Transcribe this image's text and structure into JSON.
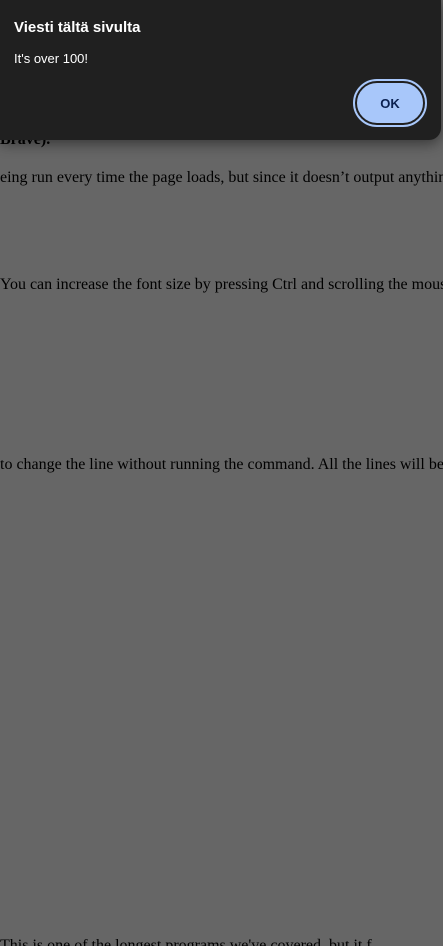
{
  "page": {
    "heading_fragment": "Brave).",
    "line_a": "eing run every time the page loads, but since it doesn’t output anything",
    "line_b": "You can increase the font size by pressing Ctrl and scrolling the mouse",
    "line_c": "to change the line without running the command. All the lines will be",
    "line_d": "This is one of the longest programs we've covered, but it f..."
  },
  "dialog": {
    "title": "Viesti tältä sivulta",
    "message": "It's over 100!",
    "ok_label": "OK"
  },
  "colors": {
    "overlay": "#666666",
    "dialog_bg": "#202020",
    "button_bg": "#a8c7fa",
    "button_text": "#0b2150"
  }
}
